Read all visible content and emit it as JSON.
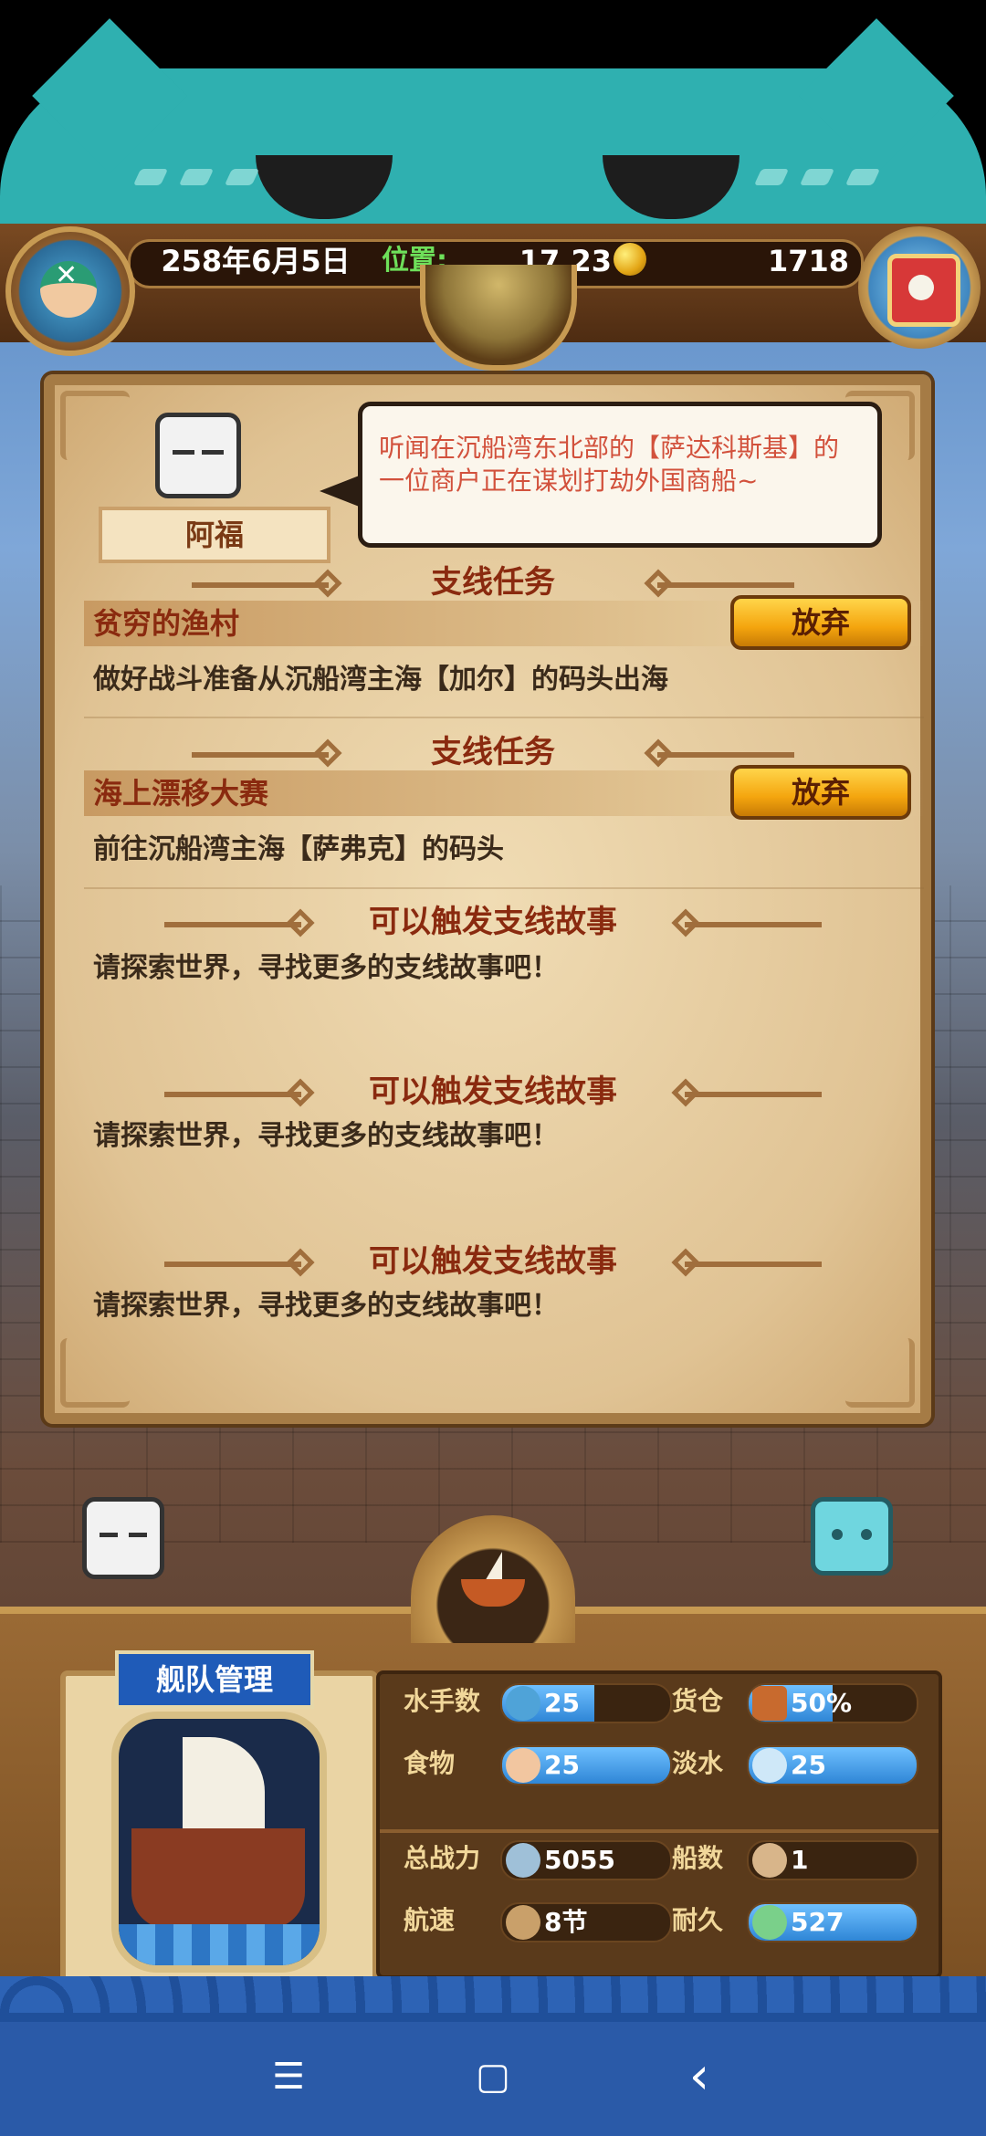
{
  "header": {
    "date": "258年6月5日",
    "position_label": "位置:",
    "position_value": "17,23",
    "gold": "1718"
  },
  "npc": {
    "name": "阿福",
    "dialog": "听闻在沉船湾东北部的【萨达科斯基】的一位商户正在谋划打劫外国商船~"
  },
  "quests": [
    {
      "section": "支线任务",
      "name": "贫穷的渔村",
      "button": "放弃",
      "desc": "做好战斗准备从沉船湾主海【加尔】的码头出海"
    },
    {
      "section": "支线任务",
      "name": "海上漂移大赛",
      "button": "放弃",
      "desc": "前往沉船湾主海【萨弗克】的码头"
    }
  ],
  "stories": [
    {
      "title": "可以触发支线故事",
      "desc": "请探索世界，寻找更多的支线故事吧！"
    },
    {
      "title": "可以触发支线故事",
      "desc": "请探索世界，寻找更多的支线故事吧！"
    },
    {
      "title": "可以触发支线故事",
      "desc": "请探索世界，寻找更多的支线故事吧！"
    }
  ],
  "fleet": {
    "title": "舰队管理",
    "stats": [
      {
        "label": "水手数",
        "value": "25",
        "fill": 0.55
      },
      {
        "label": "货仓",
        "value": "50%",
        "fill": 0.5
      },
      {
        "label": "食物",
        "value": "25",
        "fill": 1.0
      },
      {
        "label": "淡水",
        "value": "25",
        "fill": 1.0
      },
      {
        "label": "总战力",
        "value": "5055",
        "fill": 0.0
      },
      {
        "label": "船数",
        "value": "1",
        "fill": 0.0
      },
      {
        "label": "航速",
        "value": "8节",
        "fill": 0.0
      },
      {
        "label": "耐久",
        "value": "527",
        "fill": 1.0
      }
    ]
  },
  "nav": {
    "menu": "☰",
    "home": "▢",
    "back": "‹"
  },
  "colors": {
    "accent": "#8a2a0f",
    "button": "#f4a50e",
    "bar_fill": "#2f86d6",
    "cat": "#2fb0b0"
  }
}
